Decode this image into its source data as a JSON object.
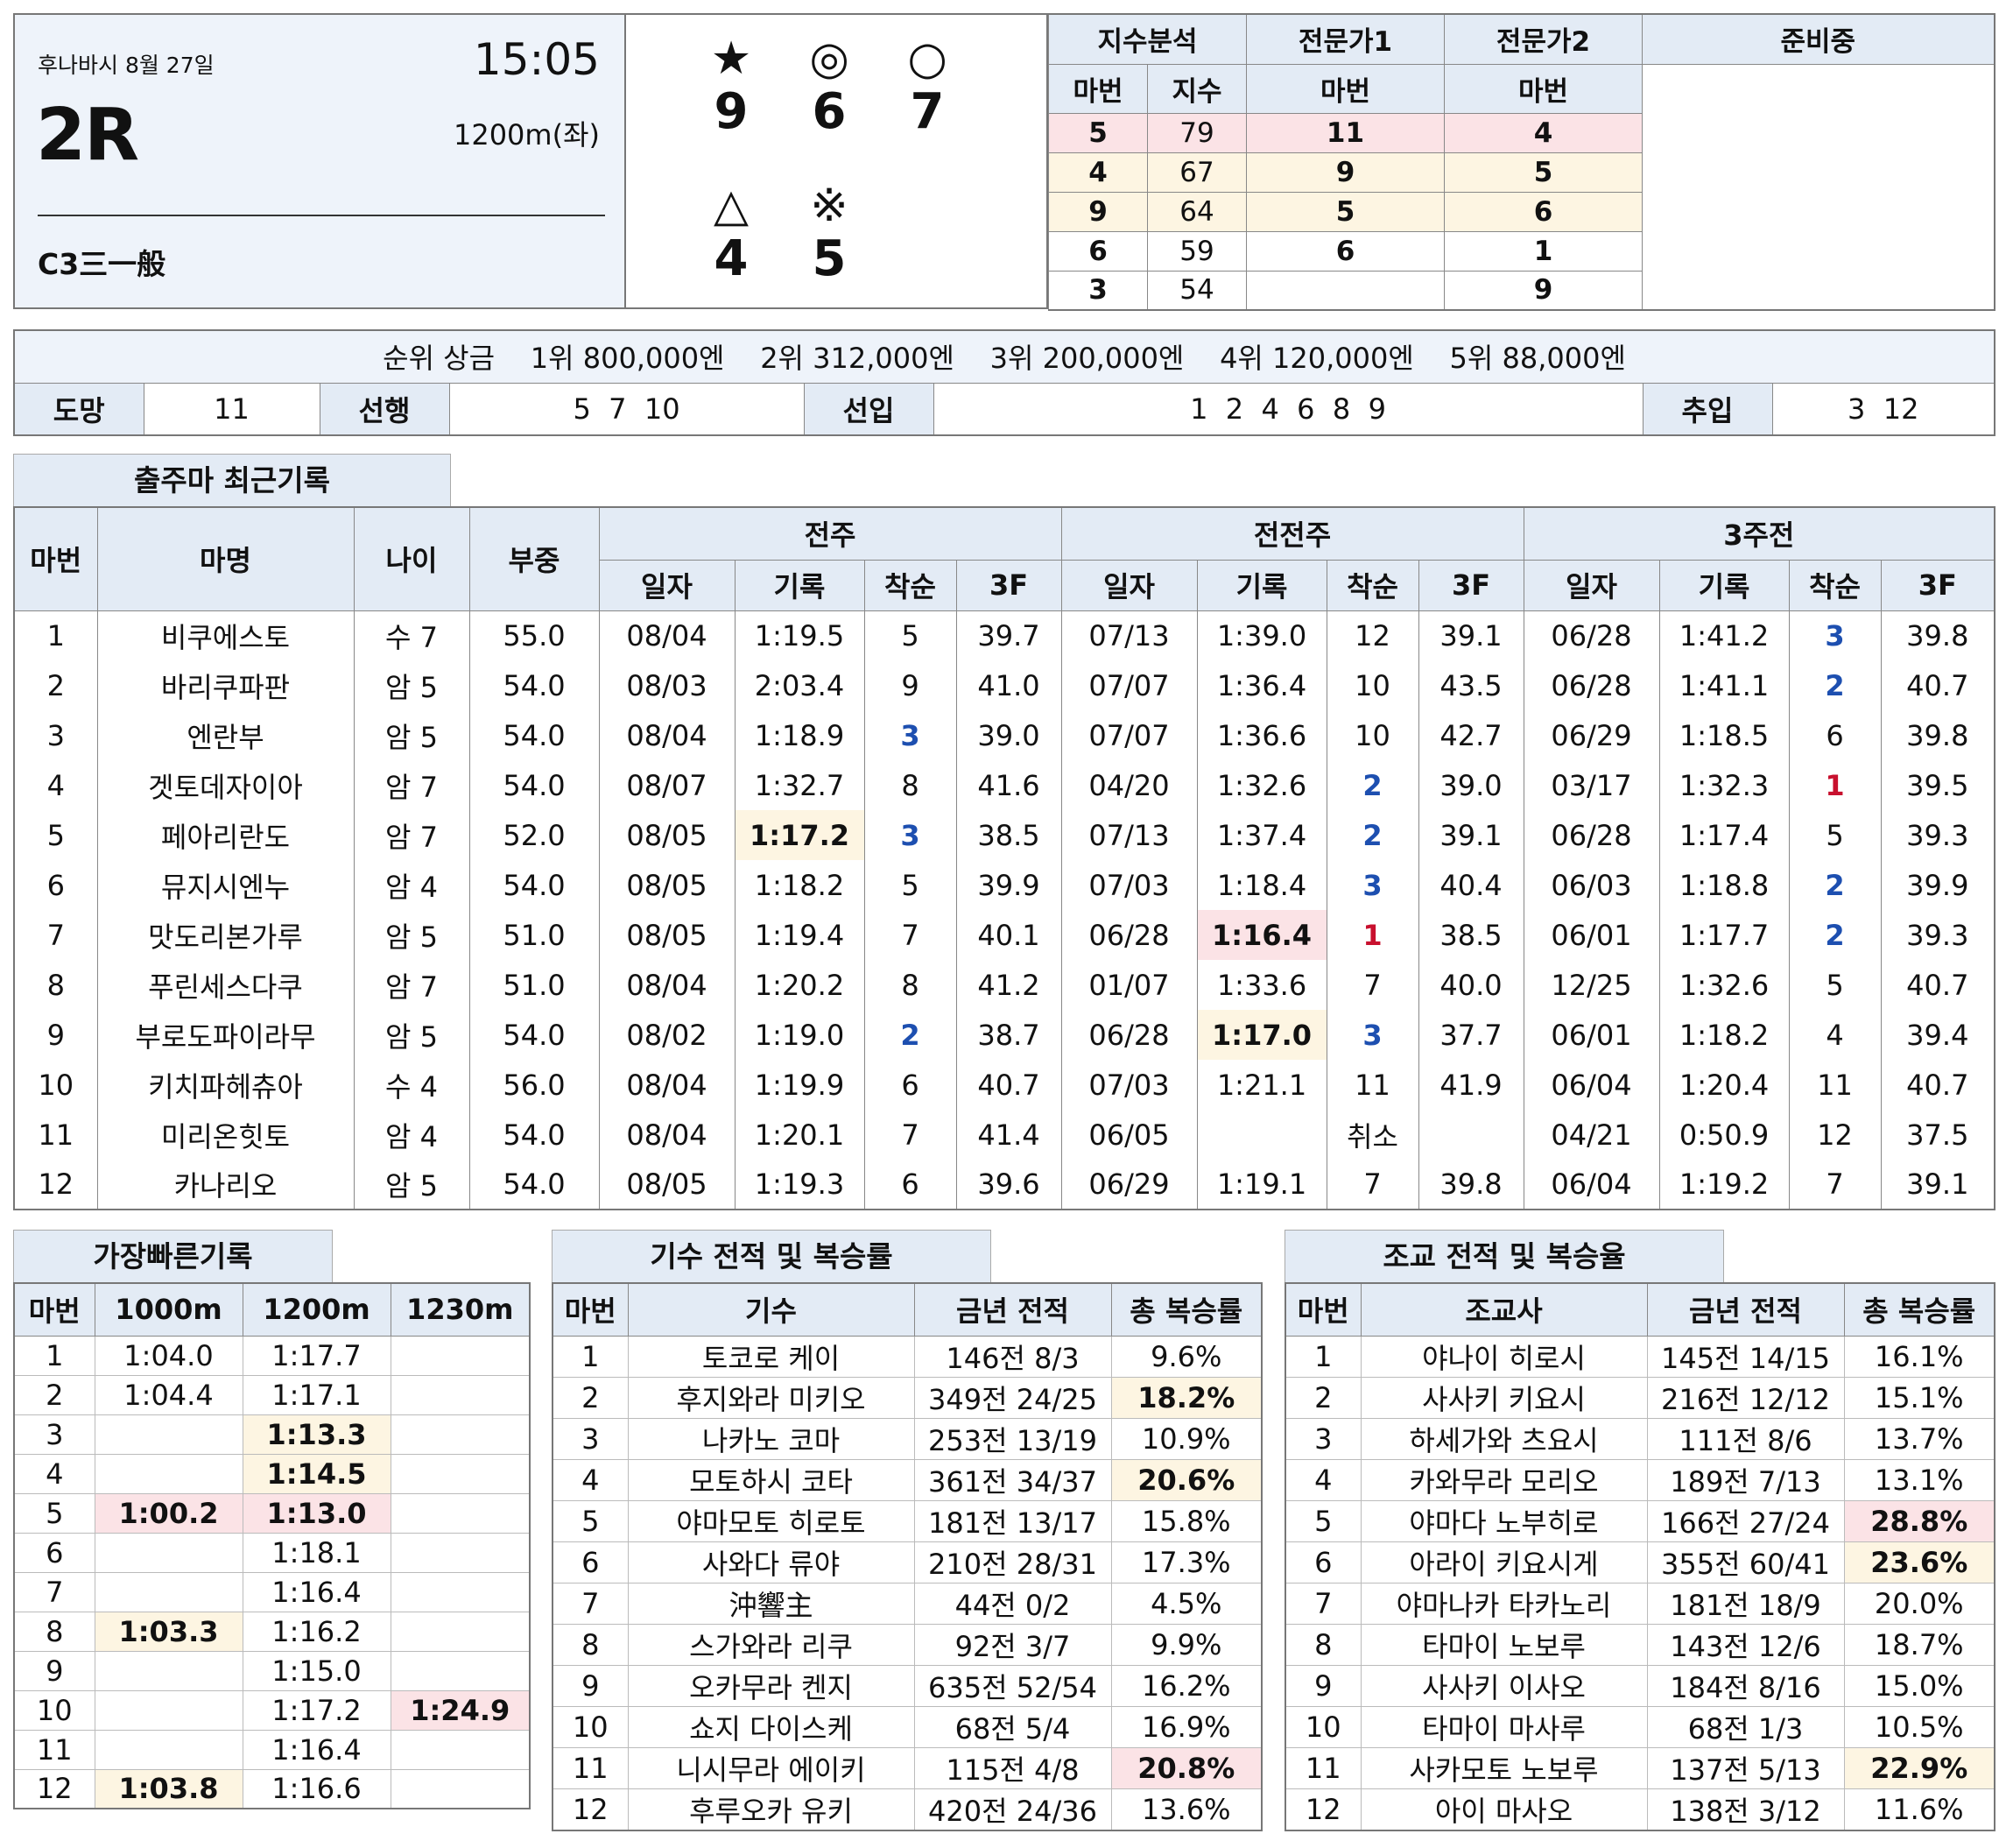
{
  "race": {
    "venue_date": "후나바시 8월 27일",
    "time": "15:05",
    "race_no": "2R",
    "distance": "1200m(좌)",
    "class": "C3三一般"
  },
  "marks": [
    {
      "symbol": "★",
      "number": "9"
    },
    {
      "symbol": "◎",
      "number": "6"
    },
    {
      "symbol": "○",
      "number": "7"
    },
    {
      "symbol": "△",
      "number": "4"
    },
    {
      "symbol": "※",
      "number": "5"
    }
  ],
  "index_analysis": {
    "headers": {
      "index": "지수분석",
      "expert1": "전문가1",
      "expert2": "전문가2",
      "preparing": "준비중"
    },
    "subheaders": {
      "horse_no": "마번",
      "score": "지수"
    },
    "rows": [
      {
        "no": "5",
        "score": "79",
        "e1": "11",
        "e2": "4"
      },
      {
        "no": "4",
        "score": "67",
        "e1": "9",
        "e2": "5"
      },
      {
        "no": "9",
        "score": "64",
        "e1": "5",
        "e2": "6"
      },
      {
        "no": "6",
        "score": "59",
        "e1": "6",
        "e2": "1"
      },
      {
        "no": "3",
        "score": "54",
        "e1": "",
        "e2": "9"
      }
    ]
  },
  "prize": {
    "label": "순위 상금",
    "items": [
      "1위 800,000엔",
      "2위 312,000엔",
      "3위 200,000엔",
      "4위 120,000엔",
      "5위 88,000엔"
    ]
  },
  "strategy": [
    {
      "label": "도망",
      "value": "11"
    },
    {
      "label": "선행",
      "value": "5  7  10"
    },
    {
      "label": "선입",
      "value": "1  2  4  6  8  9"
    },
    {
      "label": "추입",
      "value": "3  12"
    }
  ],
  "recent": {
    "title": "출주마 최근기록",
    "headers": {
      "no": "마번",
      "name": "마명",
      "age": "나이",
      "weight": "부중",
      "prev1": "전주",
      "prev2": "전전주",
      "prev3": "3주전"
    },
    "subheaders": [
      "일자",
      "기록",
      "착순",
      "3F"
    ],
    "rows": [
      {
        "no": "1",
        "name": "비쿠에스토",
        "age": "수 7",
        "wt": "55.0",
        "r": [
          [
            "08/04",
            "1:19.5",
            "5",
            "39.7"
          ],
          [
            "07/13",
            "1:39.0",
            "12",
            "39.1"
          ],
          [
            "06/28",
            "1:41.2",
            "3",
            "39.8"
          ]
        ]
      },
      {
        "no": "2",
        "name": "바리쿠파판",
        "age": "암 5",
        "wt": "54.0",
        "r": [
          [
            "08/03",
            "2:03.4",
            "9",
            "41.0"
          ],
          [
            "07/07",
            "1:36.4",
            "10",
            "43.5"
          ],
          [
            "06/28",
            "1:41.1",
            "2",
            "40.7"
          ]
        ]
      },
      {
        "no": "3",
        "name": "엔란부",
        "age": "암 5",
        "wt": "54.0",
        "r": [
          [
            "08/04",
            "1:18.9",
            "3",
            "39.0"
          ],
          [
            "07/07",
            "1:36.6",
            "10",
            "42.7"
          ],
          [
            "06/29",
            "1:18.5",
            "6",
            "39.8"
          ]
        ]
      },
      {
        "no": "4",
        "name": "겟토데자이아",
        "age": "암 7",
        "wt": "54.0",
        "r": [
          [
            "08/07",
            "1:32.7",
            "8",
            "41.6"
          ],
          [
            "04/20",
            "1:32.6",
            "2",
            "39.0"
          ],
          [
            "03/17",
            "1:32.3",
            "1",
            "39.5"
          ]
        ]
      },
      {
        "no": "5",
        "name": "페아리란도",
        "age": "암 7",
        "wt": "52.0",
        "r": [
          [
            "08/05",
            "1:17.2",
            "3",
            "38.5"
          ],
          [
            "07/13",
            "1:37.4",
            "2",
            "39.1"
          ],
          [
            "06/28",
            "1:17.4",
            "5",
            "39.3"
          ]
        ]
      },
      {
        "no": "6",
        "name": "뮤지시엔누",
        "age": "암 4",
        "wt": "54.0",
        "r": [
          [
            "08/05",
            "1:18.2",
            "5",
            "39.9"
          ],
          [
            "07/03",
            "1:18.4",
            "3",
            "40.4"
          ],
          [
            "06/03",
            "1:18.8",
            "2",
            "39.9"
          ]
        ]
      },
      {
        "no": "7",
        "name": "맛도리본가루",
        "age": "암 5",
        "wt": "51.0",
        "r": [
          [
            "08/05",
            "1:19.4",
            "7",
            "40.1"
          ],
          [
            "06/28",
            "1:16.4",
            "1",
            "38.5"
          ],
          [
            "06/01",
            "1:17.7",
            "2",
            "39.3"
          ]
        ]
      },
      {
        "no": "8",
        "name": "푸린세스다쿠",
        "age": "암 7",
        "wt": "51.0",
        "r": [
          [
            "08/04",
            "1:20.2",
            "8",
            "41.2"
          ],
          [
            "01/07",
            "1:33.6",
            "7",
            "40.0"
          ],
          [
            "12/25",
            "1:32.6",
            "5",
            "40.7"
          ]
        ]
      },
      {
        "no": "9",
        "name": "부로도파이라무",
        "age": "암 5",
        "wt": "54.0",
        "r": [
          [
            "08/02",
            "1:19.0",
            "2",
            "38.7"
          ],
          [
            "06/28",
            "1:17.0",
            "3",
            "37.7"
          ],
          [
            "06/01",
            "1:18.2",
            "4",
            "39.4"
          ]
        ]
      },
      {
        "no": "10",
        "name": "키치파헤츄아",
        "age": "수 4",
        "wt": "56.0",
        "r": [
          [
            "08/04",
            "1:19.9",
            "6",
            "40.7"
          ],
          [
            "07/03",
            "1:21.1",
            "11",
            "41.9"
          ],
          [
            "06/04",
            "1:20.4",
            "11",
            "40.7"
          ]
        ]
      },
      {
        "no": "11",
        "name": "미리온힛토",
        "age": "암 4",
        "wt": "54.0",
        "r": [
          [
            "08/04",
            "1:20.1",
            "7",
            "41.4"
          ],
          [
            "06/05",
            "",
            "취소",
            ""
          ],
          [
            "04/21",
            "0:50.9",
            "12",
            "37.5"
          ]
        ]
      },
      {
        "no": "12",
        "name": "카나리오",
        "age": "암 5",
        "wt": "54.0",
        "r": [
          [
            "08/05",
            "1:19.3",
            "6",
            "39.6"
          ],
          [
            "06/29",
            "1:19.1",
            "7",
            "39.8"
          ],
          [
            "06/04",
            "1:19.2",
            "7",
            "39.1"
          ]
        ]
      }
    ]
  },
  "fastest": {
    "title": "가장빠른기록",
    "headers": [
      "마번",
      "1000m",
      "1200m",
      "1230m"
    ],
    "rows": [
      [
        "1",
        "1:04.0",
        "1:17.7",
        ""
      ],
      [
        "2",
        "1:04.4",
        "1:17.1",
        ""
      ],
      [
        "3",
        "",
        "1:13.3",
        ""
      ],
      [
        "4",
        "",
        "1:14.5",
        ""
      ],
      [
        "5",
        "1:00.2",
        "1:13.0",
        ""
      ],
      [
        "6",
        "",
        "1:18.1",
        ""
      ],
      [
        "7",
        "",
        "1:16.4",
        ""
      ],
      [
        "8",
        "1:03.3",
        "1:16.2",
        ""
      ],
      [
        "9",
        "",
        "1:15.0",
        ""
      ],
      [
        "10",
        "",
        "1:17.2",
        "1:24.9"
      ],
      [
        "11",
        "",
        "1:16.4",
        ""
      ],
      [
        "12",
        "1:03.8",
        "1:16.6",
        ""
      ]
    ]
  },
  "jockey": {
    "title": "기수 전적 및 복승률",
    "headers": [
      "마번",
      "기수",
      "금년 전적",
      "총 복승률"
    ],
    "rows": [
      [
        "1",
        "토코로 케이",
        "146전 8/3",
        "9.6%"
      ],
      [
        "2",
        "후지와라 미키오",
        "349전 24/25",
        "18.2%"
      ],
      [
        "3",
        "나카노 코마",
        "253전 13/19",
        "10.9%"
      ],
      [
        "4",
        "모토하시 코타",
        "361전 34/37",
        "20.6%"
      ],
      [
        "5",
        "야마모토 히로토",
        "181전 13/17",
        "15.8%"
      ],
      [
        "6",
        "사와다 류야",
        "210전 28/31",
        "17.3%"
      ],
      [
        "7",
        "沖響主",
        "44전 0/2",
        "4.5%"
      ],
      [
        "8",
        "스가와라 리쿠",
        "92전 3/7",
        "9.9%"
      ],
      [
        "9",
        "오카무라 켄지",
        "635전 52/54",
        "16.2%"
      ],
      [
        "10",
        "쇼지 다이스케",
        "68전 5/4",
        "16.9%"
      ],
      [
        "11",
        "니시무라 에이키",
        "115전 4/8",
        "20.8%"
      ],
      [
        "12",
        "후루오카 유키",
        "420전 24/36",
        "13.6%"
      ]
    ]
  },
  "trainer": {
    "title": "조교 전적 및 복승율",
    "headers": [
      "마번",
      "조교사",
      "금년 전적",
      "총 복승률"
    ],
    "rows": [
      [
        "1",
        "야나이 히로시",
        "145전 14/15",
        "16.1%"
      ],
      [
        "2",
        "사사키 키요시",
        "216전 12/12",
        "15.1%"
      ],
      [
        "3",
        "하세가와 츠요시",
        "111전 8/6",
        "13.7%"
      ],
      [
        "4",
        "카와무라 모리오",
        "189전 7/13",
        "13.1%"
      ],
      [
        "5",
        "야마다 노부히로",
        "166전 27/24",
        "28.8%"
      ],
      [
        "6",
        "아라이 키요시게",
        "355전 60/41",
        "23.6%"
      ],
      [
        "7",
        "야마나카 타카노리",
        "181전 18/9",
        "20.0%"
      ],
      [
        "8",
        "타마이 노보루",
        "143전 12/6",
        "18.7%"
      ],
      [
        "9",
        "사사키 이사오",
        "184전 8/16",
        "15.0%"
      ],
      [
        "10",
        "타마이 마사루",
        "68전 1/3",
        "10.5%"
      ],
      [
        "11",
        "사카모토 노보루",
        "137전 5/13",
        "22.9%"
      ],
      [
        "12",
        "아이 마사오",
        "138전 3/12",
        "11.6%"
      ]
    ]
  },
  "colors": {
    "pink": "#fbe3e6",
    "cream": "#fdf5e2",
    "header": "#e3ebf5",
    "info_bg": "#eef3fa",
    "place_blue": "#1d4fb0",
    "win_red": "#c8102e"
  }
}
